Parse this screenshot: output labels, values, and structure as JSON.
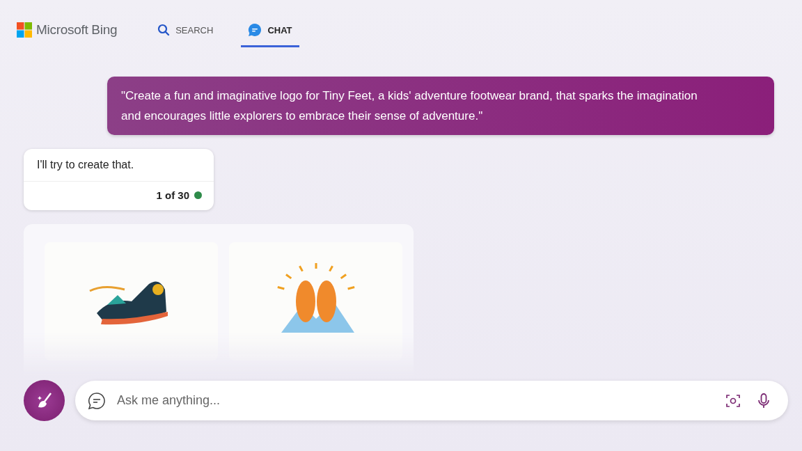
{
  "header": {
    "brand": "Microsoft Bing"
  },
  "tabs": [
    {
      "kind": "search",
      "label": "SEARCH",
      "selected": false
    },
    {
      "kind": "chat",
      "label": "CHAT",
      "selected": true
    }
  ],
  "messages": [
    {
      "kind": "user",
      "text": "\"Create a fun and imaginative logo for Tiny Feet, a kids' adventure footwear brand, that sparks the imagination and encourages little explorers to embrace their sense of adventure.\""
    },
    {
      "kind": "bot",
      "text": "I'll try to create that.",
      "counter": "1 of 30"
    },
    {
      "kind": "images",
      "images": [
        {
          "kind": "shoe"
        },
        {
          "kind": "feet"
        }
      ]
    }
  ],
  "composer": {
    "placeholder": "Ask me anything..."
  }
}
